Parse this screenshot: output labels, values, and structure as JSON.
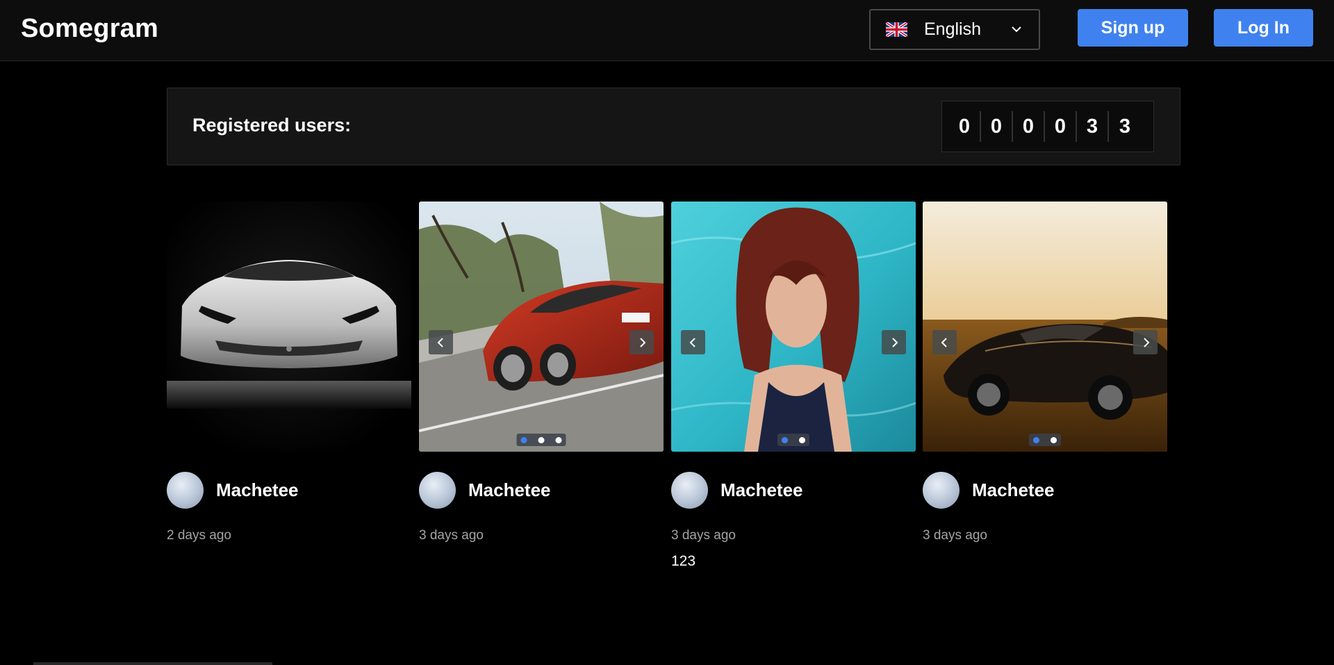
{
  "header": {
    "logo": "Somegram",
    "language": {
      "selected": "English",
      "flag": "uk-flag-icon"
    },
    "signup_label": "Sign up",
    "login_label": "Log In"
  },
  "registered": {
    "label": "Registered users:",
    "digits": [
      "0",
      "0",
      "0",
      "0",
      "3",
      "3"
    ]
  },
  "posts": [
    {
      "author": "Machetee",
      "time": "2 days ago",
      "caption": "",
      "image": "white sports car",
      "slides": 1,
      "active_slide": 0
    },
    {
      "author": "Machetee",
      "time": "3 days ago",
      "caption": "",
      "image": "red sports car on road",
      "slides": 3,
      "active_slide": 0
    },
    {
      "author": "Machetee",
      "time": "3 days ago",
      "caption": "123",
      "image": "woman in pool",
      "slides": 2,
      "active_slide": 0
    },
    {
      "author": "Machetee",
      "time": "3 days ago",
      "caption": "",
      "image": "black car at sunset",
      "slides": 2,
      "active_slide": 0
    }
  ],
  "colors": {
    "accent": "#3f82ef",
    "background": "#000000",
    "panel": "#151515"
  }
}
